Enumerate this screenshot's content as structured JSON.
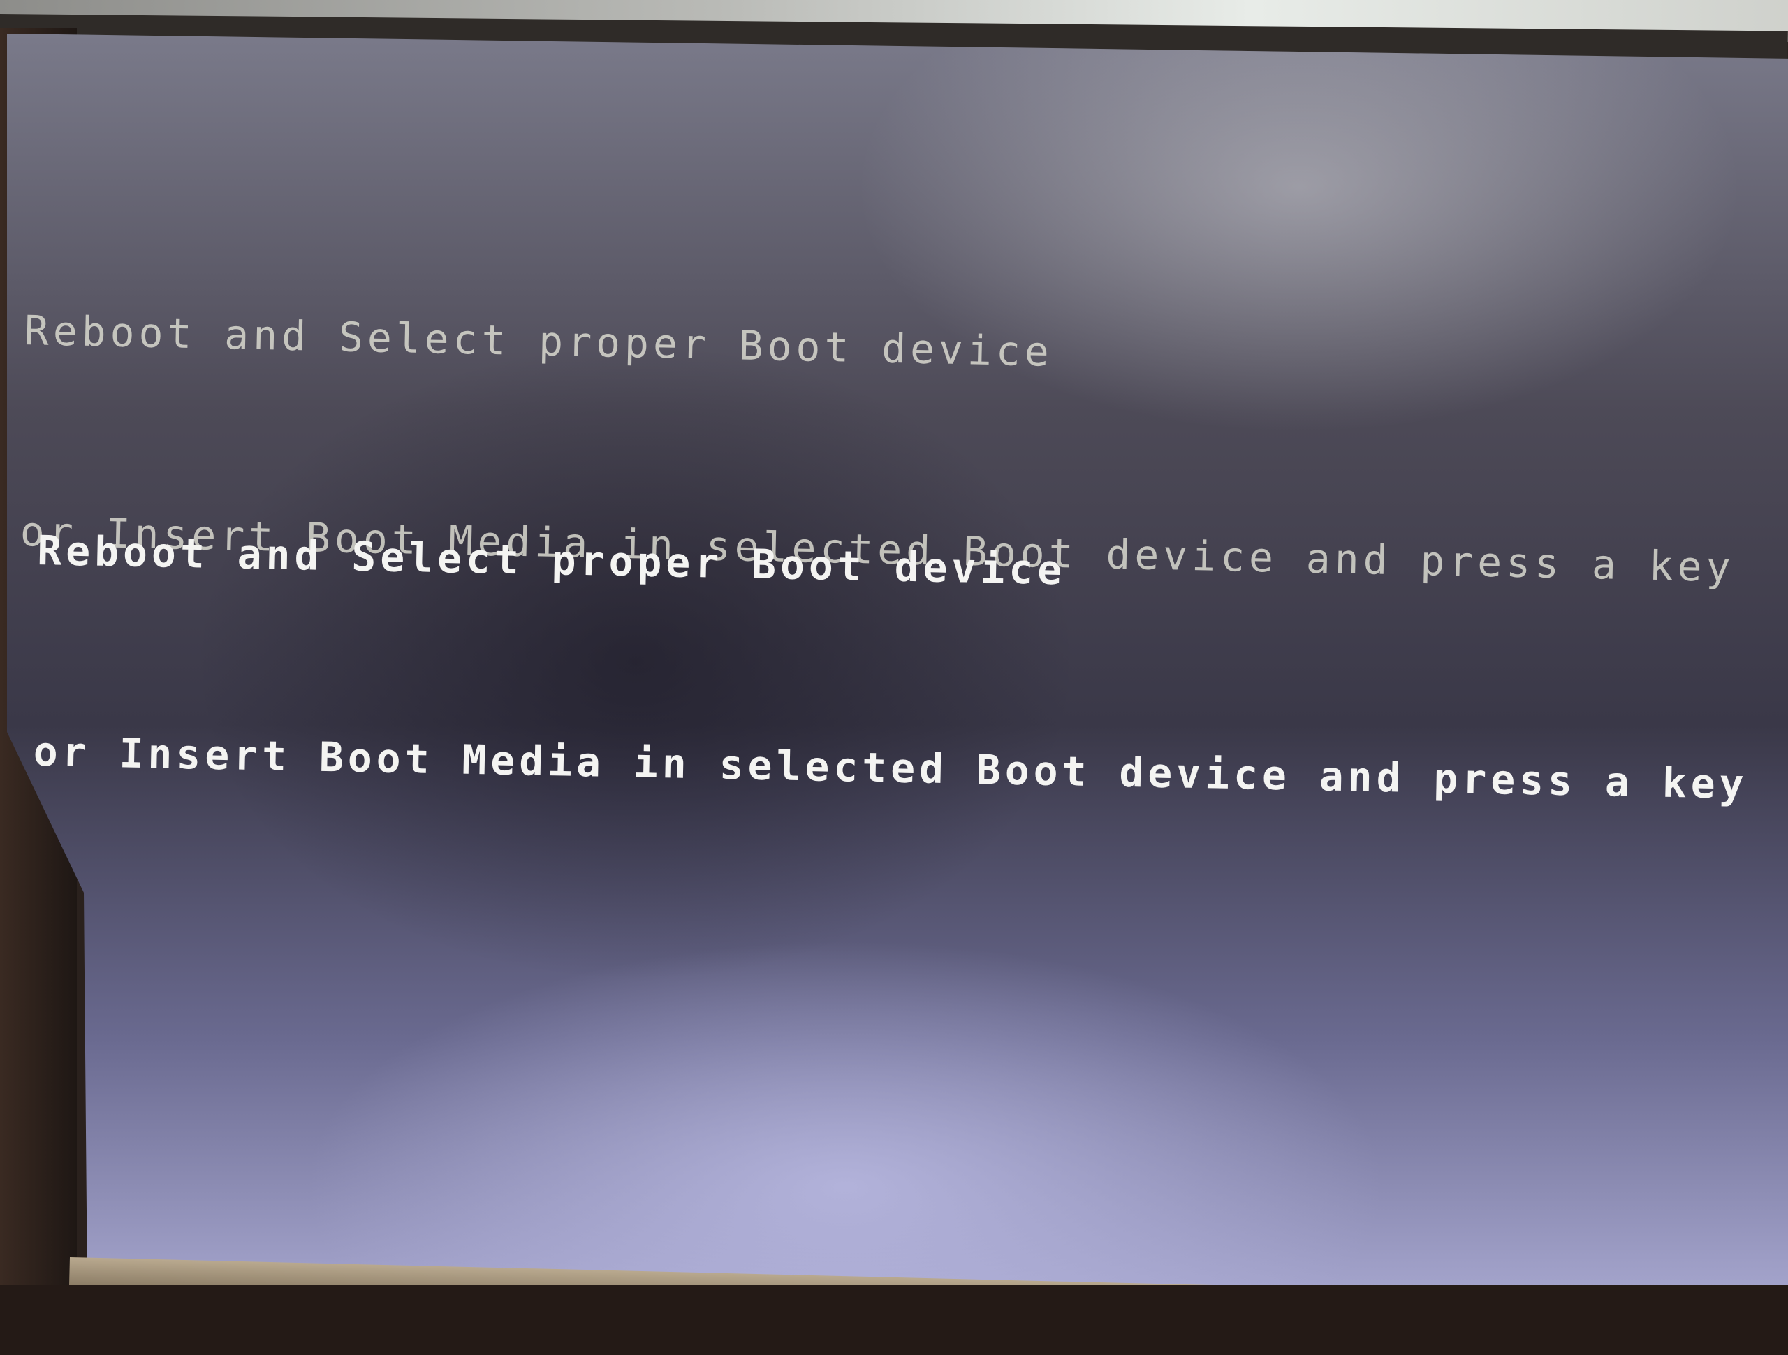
{
  "screen": {
    "type": "bios-boot-error",
    "background_color": "#3f3d4f",
    "text_color": "#f4f4f2",
    "ghost_message": {
      "line1": "Reboot and Select proper Boot device",
      "line2": "or Insert Boot Media in selected Boot device and press a key"
    },
    "message": {
      "line1": "Reboot and Select proper Boot device",
      "line2": "or Insert Boot Media in selected Boot device and press a key"
    }
  }
}
